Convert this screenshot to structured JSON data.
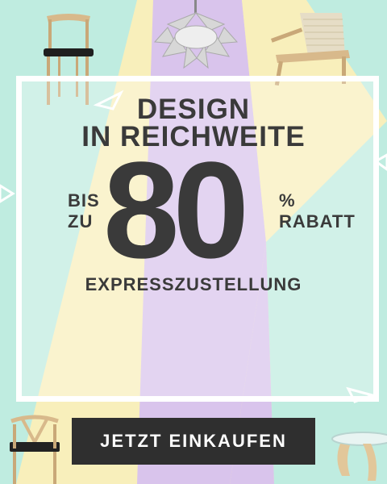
{
  "headline": {
    "line1": "DESIGN",
    "line2": "IN REICHWEITE"
  },
  "discount": {
    "prefix_line1": "BIS",
    "prefix_line2": "ZU",
    "value": "80",
    "suffix_line1": "%",
    "suffix_line2": "RABATT"
  },
  "subline": "EXPRESSZUSTELLUNG",
  "cta": {
    "label": "JETZT EINKAUFEN"
  },
  "colors": {
    "mint": "#bfece0",
    "lavender": "#d8c4ec",
    "pale_yellow": "#f8f0b8",
    "text": "#3a3a3a",
    "button": "#2f2f2f"
  },
  "decor_icons": [
    "chair-icon",
    "pendant-lamp-icon",
    "lounge-chair-icon",
    "wishbone-chair-icon",
    "coffee-table-icon"
  ]
}
